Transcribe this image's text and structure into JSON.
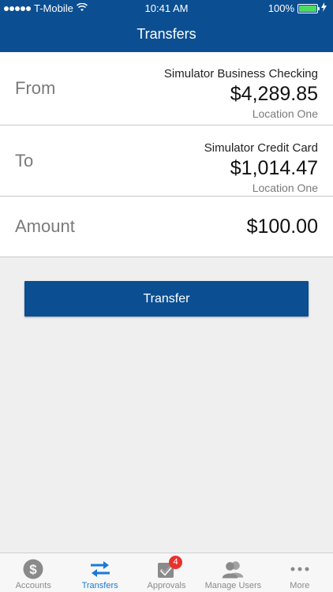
{
  "status_bar": {
    "carrier": "T-Mobile",
    "time": "10:41 AM",
    "battery": "100%"
  },
  "header": {
    "title": "Transfers"
  },
  "from": {
    "label": "From",
    "account": "Simulator Business Checking",
    "amount": "$4,289.85",
    "location": "Location One"
  },
  "to": {
    "label": "To",
    "account": "Simulator Credit Card",
    "amount": "$1,014.47",
    "location": "Location One"
  },
  "amount": {
    "label": "Amount",
    "value": "$100.00"
  },
  "action": {
    "transfer_label": "Transfer"
  },
  "tabbar": {
    "tabs": [
      {
        "label": "Accounts",
        "icon": "dollar-icon"
      },
      {
        "label": "Transfers",
        "icon": "transfer-arrows-icon"
      },
      {
        "label": "Approvals",
        "icon": "checkmark-icon",
        "badge": "4"
      },
      {
        "label": "Manage Users",
        "icon": "users-icon"
      },
      {
        "label": "More",
        "icon": "ellipsis-icon"
      }
    ],
    "active_tab": "Transfers"
  },
  "colors": {
    "brand": "#0b4f92",
    "active_tab": "#1a7ad6",
    "badge": "#e8322d",
    "battery": "#4cd964"
  }
}
